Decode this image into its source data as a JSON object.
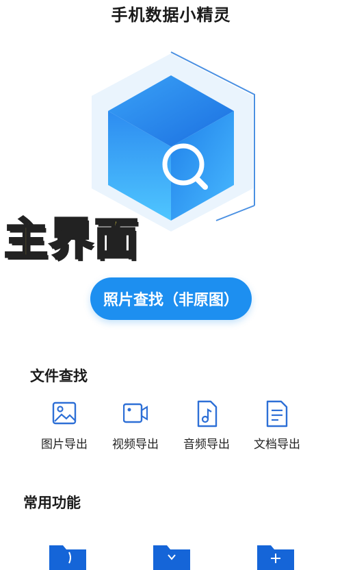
{
  "app": {
    "title": "手机数据小精灵"
  },
  "overlay": {
    "text": "主界面"
  },
  "primary_button": {
    "label": "照片查找（非原图）"
  },
  "file_search": {
    "title": "文件查找",
    "items": [
      {
        "label": "图片导出",
        "icon": "image-icon"
      },
      {
        "label": "视频导出",
        "icon": "video-icon"
      },
      {
        "label": "音频导出",
        "icon": "music-file-icon"
      },
      {
        "label": "文档导出",
        "icon": "document-icon"
      }
    ]
  },
  "common_functions": {
    "title": "常用功能",
    "items": [
      {
        "icon": "folder-icon"
      },
      {
        "icon": "folder-icon"
      },
      {
        "icon": "folder-icon"
      }
    ]
  },
  "colors": {
    "accent": "#1d8ff0",
    "icon_stroke": "#2d6fd6",
    "overlay_text": "#f7e84a"
  }
}
